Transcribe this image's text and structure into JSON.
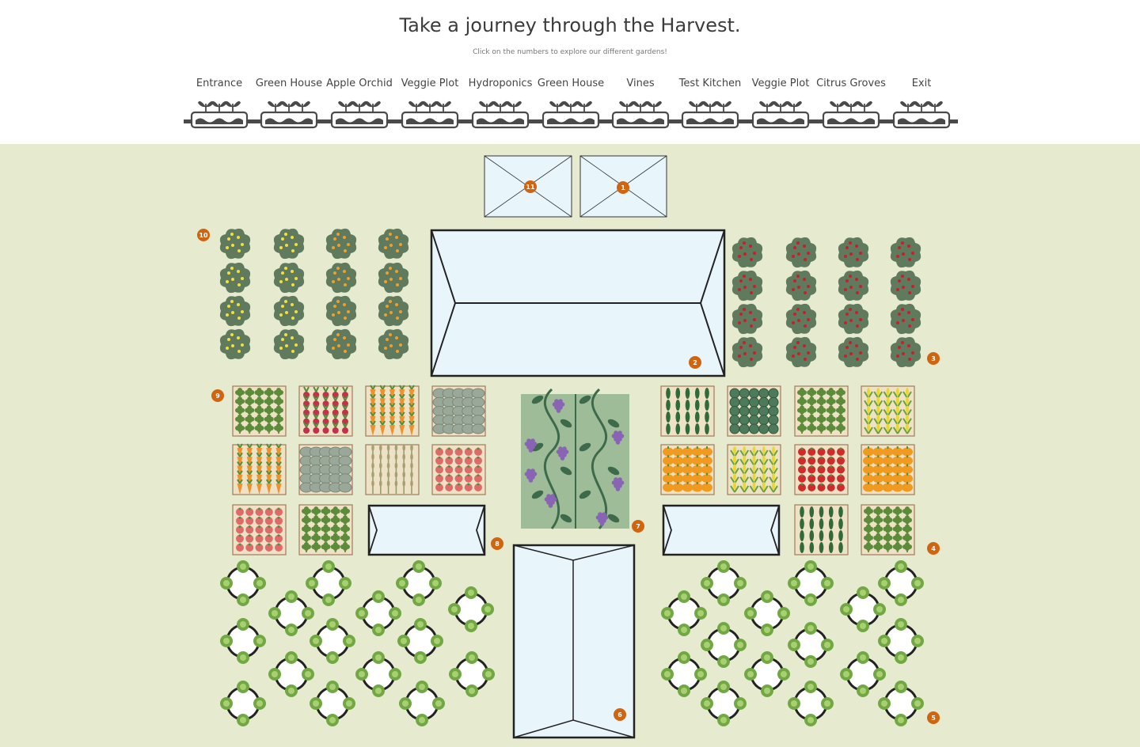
{
  "header": {
    "title": "Take a journey through the Harvest.",
    "subtitle": "Click on the numbers to explore our different gardens!"
  },
  "nav": {
    "items": [
      {
        "label": "Entrance"
      },
      {
        "label": "Green House"
      },
      {
        "label": "Apple Orchid"
      },
      {
        "label": "Veggie Plot"
      },
      {
        "label": "Hydroponics"
      },
      {
        "label": "Green House"
      },
      {
        "label": "Vines"
      },
      {
        "label": "Test Kitchen"
      },
      {
        "label": "Veggie Plot"
      },
      {
        "label": "Citrus Groves"
      },
      {
        "label": "Exit"
      }
    ]
  },
  "map": {
    "markers": [
      "1",
      "2",
      "3",
      "4",
      "5",
      "6",
      "7",
      "8",
      "9",
      "10",
      "11"
    ],
    "colors": {
      "background": "#e6ebd0",
      "marker": "#d0640f",
      "tree": "#5f7a5c",
      "lemon": "#f4e03a",
      "orange": "#f0a02a",
      "apple": "#c8202a",
      "glass": "#e8f6fc",
      "bed": "#ede2c6",
      "vine": "#9fbc98",
      "grape": "#8a64b4",
      "lettuce": "#72a844"
    },
    "beds_left": [
      "broccoli",
      "radish",
      "carrot",
      "cabbage",
      "carrot",
      "cabbage",
      "wheat",
      "tomato",
      "tomato",
      "broccoli"
    ],
    "beds_right": [
      "cucumber",
      "artichoke",
      "broccoli",
      "corn",
      "pumpkin",
      "corn",
      "tomato-red",
      "pumpkin",
      "cucumber",
      "broccoli"
    ]
  }
}
